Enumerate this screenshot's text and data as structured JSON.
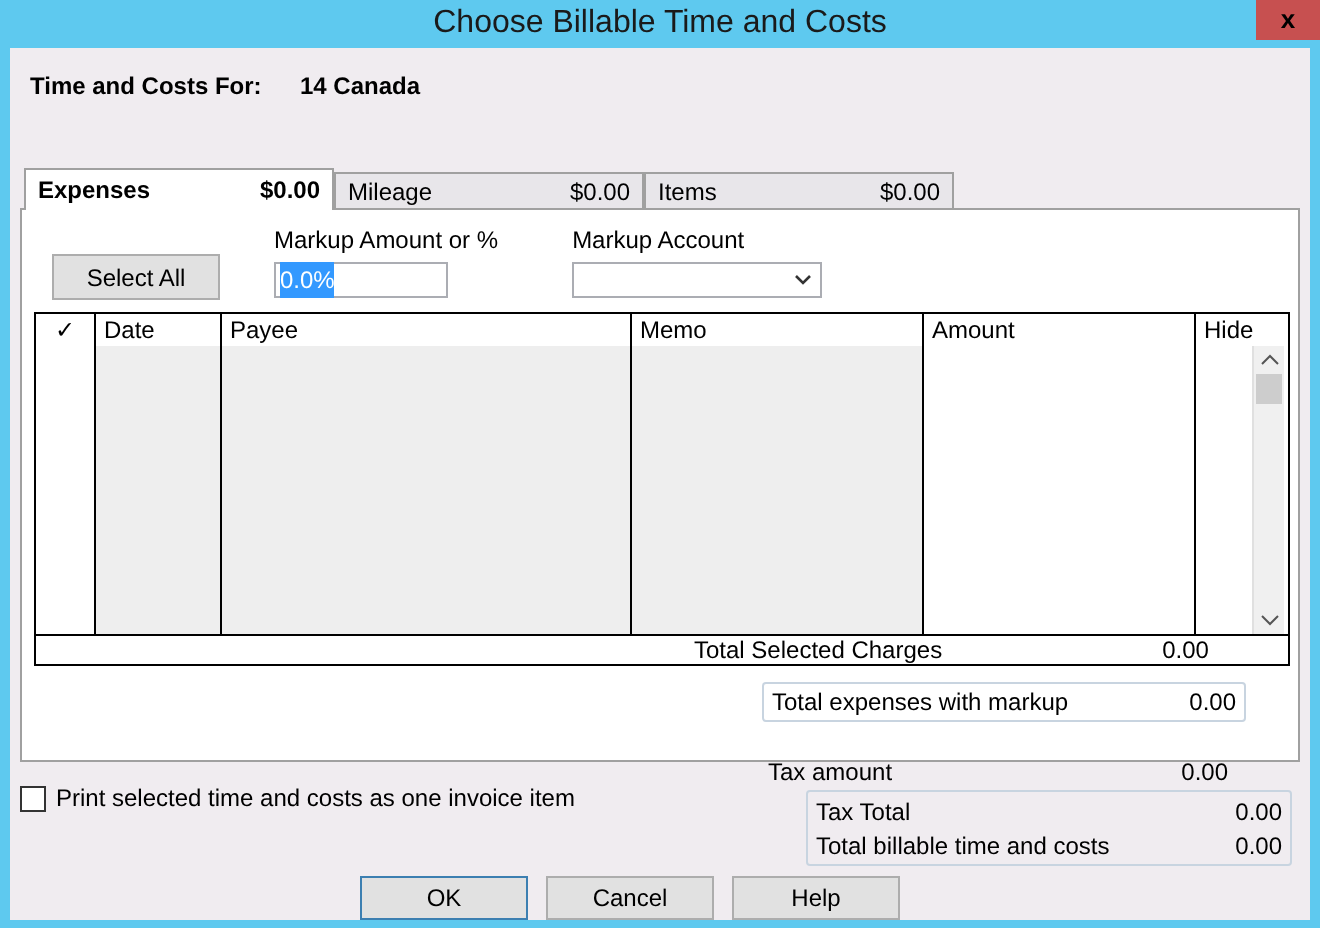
{
  "window": {
    "title": "Choose Billable Time and Costs",
    "close": "x"
  },
  "header": {
    "label": "Time and Costs For:",
    "value": "14 Canada"
  },
  "tabs": [
    {
      "label": "Expenses",
      "amount": "$0.00",
      "selected": true
    },
    {
      "label": "Mileage",
      "amount": "$0.00",
      "selected": false
    },
    {
      "label": "Items",
      "amount": "$0.00",
      "selected": false
    }
  ],
  "select_all": "Select All",
  "markup_amount": {
    "label": "Markup Amount or %",
    "value": "0.0%",
    "highlighted": true
  },
  "markup_account": {
    "label": "Markup Account"
  },
  "table": {
    "columns": [
      {
        "label": "✓",
        "shaded": false
      },
      {
        "label": "Date",
        "shaded": true
      },
      {
        "label": "Payee",
        "shaded": true
      },
      {
        "label": "Memo",
        "shaded": true
      },
      {
        "label": "Amount",
        "shaded": false
      },
      {
        "label": "Hide",
        "shaded": false
      }
    ],
    "total": {
      "label": "Total Selected Charges",
      "value": "0.00"
    }
  },
  "markup_total": {
    "label": "Total expenses with markup",
    "value": "0.00"
  },
  "tax_amount": {
    "label": "Tax amount",
    "value": "0.00"
  },
  "totals": [
    {
      "label": "Tax Total",
      "value": "0.00"
    },
    {
      "label": "Total billable time and costs",
      "value": "0.00"
    }
  ],
  "print_option": {
    "label": "Print selected time and costs as one invoice item",
    "checked": false
  },
  "buttons": [
    {
      "label": "OK",
      "default": true
    },
    {
      "label": "Cancel",
      "default": false
    },
    {
      "label": "Help",
      "default": false
    }
  ]
}
